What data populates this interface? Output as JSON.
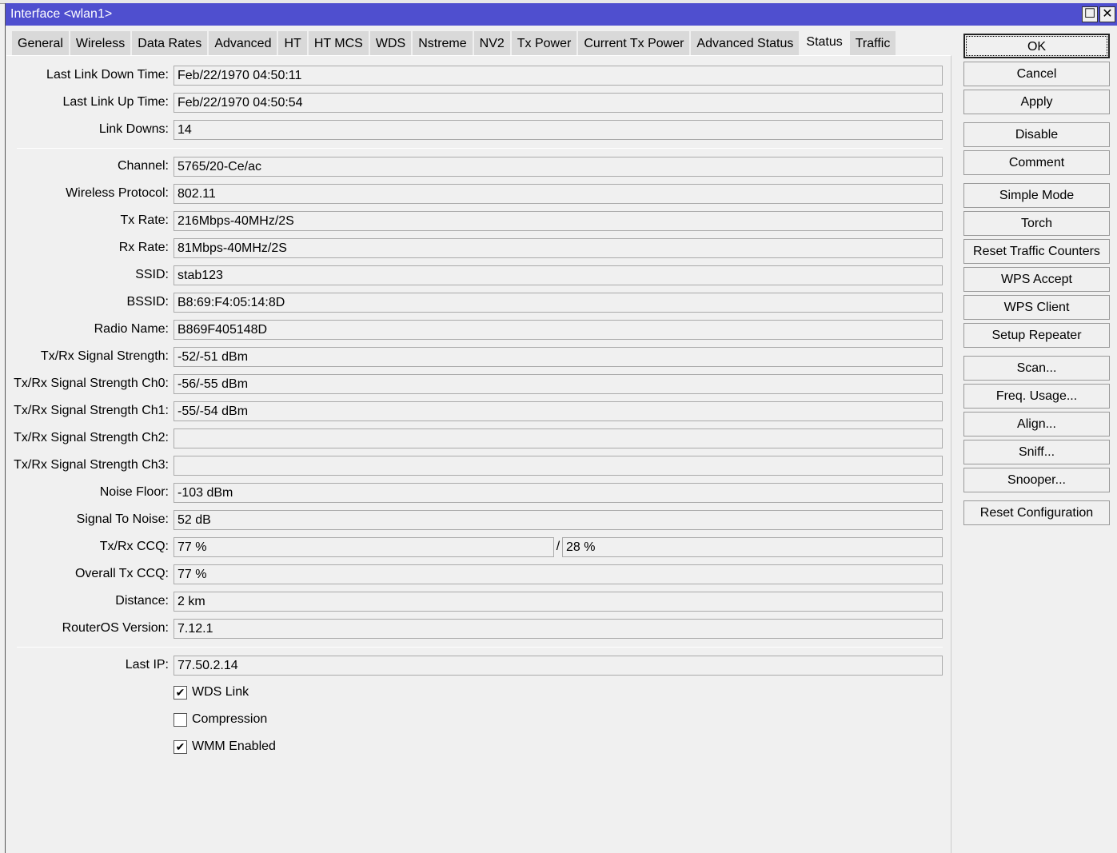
{
  "window": {
    "title": "Interface <wlan1>",
    "maximize": "☐",
    "close": "✕"
  },
  "tabs": [
    "General",
    "Wireless",
    "Data Rates",
    "Advanced",
    "HT",
    "HT MCS",
    "WDS",
    "Nstreme",
    "NV2",
    "Tx Power",
    "Current Tx Power",
    "Advanced Status",
    "Status",
    "Traffic"
  ],
  "active_tab": "Status",
  "fields": [
    {
      "label": "Last Link Down Time:",
      "value": "Feb/22/1970 04:50:11"
    },
    {
      "label": "Last Link Up Time:",
      "value": "Feb/22/1970 04:50:54"
    },
    {
      "label": "Link Downs:",
      "value": "14"
    },
    {
      "label": "Channel:",
      "value": "5765/20-Ce/ac"
    },
    {
      "label": "Wireless Protocol:",
      "value": "802.11"
    },
    {
      "label": "Tx Rate:",
      "value": "216Mbps-40MHz/2S"
    },
    {
      "label": "Rx Rate:",
      "value": "81Mbps-40MHz/2S"
    },
    {
      "label": "SSID:",
      "value": "stab123"
    },
    {
      "label": "BSSID:",
      "value": "B8:69:F4:05:14:8D"
    },
    {
      "label": "Radio Name:",
      "value": "B869F405148D"
    },
    {
      "label": "Tx/Rx Signal Strength:",
      "value": "-52/-51 dBm"
    },
    {
      "label": "Tx/Rx Signal Strength Ch0:",
      "value": "-56/-55 dBm"
    },
    {
      "label": "Tx/Rx Signal Strength Ch1:",
      "value": "-55/-54 dBm"
    },
    {
      "label": "Tx/Rx Signal Strength Ch2:",
      "value": ""
    },
    {
      "label": "Tx/Rx Signal Strength Ch3:",
      "value": ""
    },
    {
      "label": "Noise Floor:",
      "value": "-103 dBm"
    },
    {
      "label": "Signal To Noise:",
      "value": "52 dB"
    },
    {
      "label": "Tx/Rx CCQ:",
      "value": "77 %",
      "value2": "28 %",
      "sep": "/"
    },
    {
      "label": "Overall Tx CCQ:",
      "value": "77 %"
    },
    {
      "label": "Distance:",
      "value": "2 km"
    },
    {
      "label": "RouterOS Version:",
      "value": "7.12.1"
    },
    {
      "label": "Last IP:",
      "value": "77.50.2.14"
    }
  ],
  "checkboxes": [
    {
      "label": "WDS Link",
      "checked": true
    },
    {
      "label": "Compression",
      "checked": false
    },
    {
      "label": "WMM Enabled",
      "checked": true
    }
  ],
  "buttons": [
    "OK",
    "Cancel",
    "Apply",
    "Disable",
    "Comment",
    "Simple Mode",
    "Torch",
    "Reset Traffic Counters",
    "WPS Accept",
    "WPS Client",
    "Setup Repeater",
    "Scan...",
    "Freq. Usage...",
    "Align...",
    "Sniff...",
    "Snooper...",
    "Reset Configuration"
  ]
}
